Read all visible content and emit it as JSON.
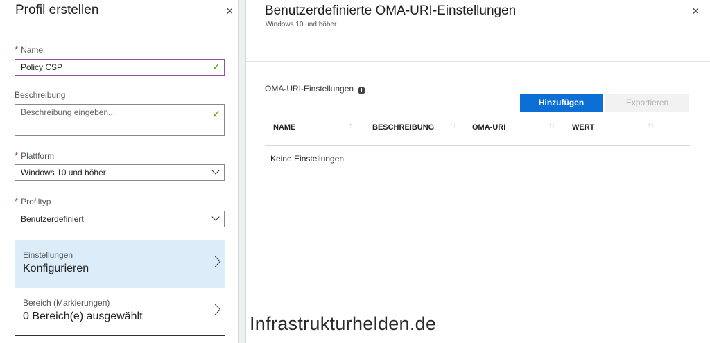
{
  "left_blade": {
    "title": "Profil erstellen",
    "close_glyph": "×",
    "name": {
      "label": "Name",
      "required_mark": "*",
      "value": "Policy CSP"
    },
    "beschreibung": {
      "label": "Beschreibung",
      "placeholder": "Beschreibung eingeben..."
    },
    "plattform": {
      "label": "Plattform",
      "required_mark": "*",
      "value": "Windows 10 und höher"
    },
    "profiltyp": {
      "label": "Profiltyp",
      "required_mark": "*",
      "value": "Benutzerdefiniert"
    },
    "einstellungen": {
      "label": "Einstellungen",
      "value": "Konfigurieren"
    },
    "bereich": {
      "label": "Bereich (Markierungen)",
      "value": "0 Bereich(e) ausgewählt"
    }
  },
  "right_blade": {
    "title": "Benutzerdefinierte OMA-URI-Einstellungen",
    "subtitle": "Windows 10 und höher",
    "close_glyph": "×",
    "section_label": "OMA-URI-Einstellungen",
    "add_button": "Hinzufügen",
    "export_button": "Exportieren",
    "columns": [
      "NAME",
      "BESCHREIBUNG",
      "OMA-URI",
      "WERT"
    ],
    "sort_glyph": "↑↓",
    "empty_text": "Keine Einstellungen"
  },
  "watermark": "Infrastrukturhelden.de",
  "colors": {
    "primary_button": "#0b6fd6",
    "selected_nav": "#dcecf9",
    "valid_check": "#57a300",
    "required_mark": "#d13438"
  },
  "icons": {
    "check": "✓",
    "info": "i"
  }
}
